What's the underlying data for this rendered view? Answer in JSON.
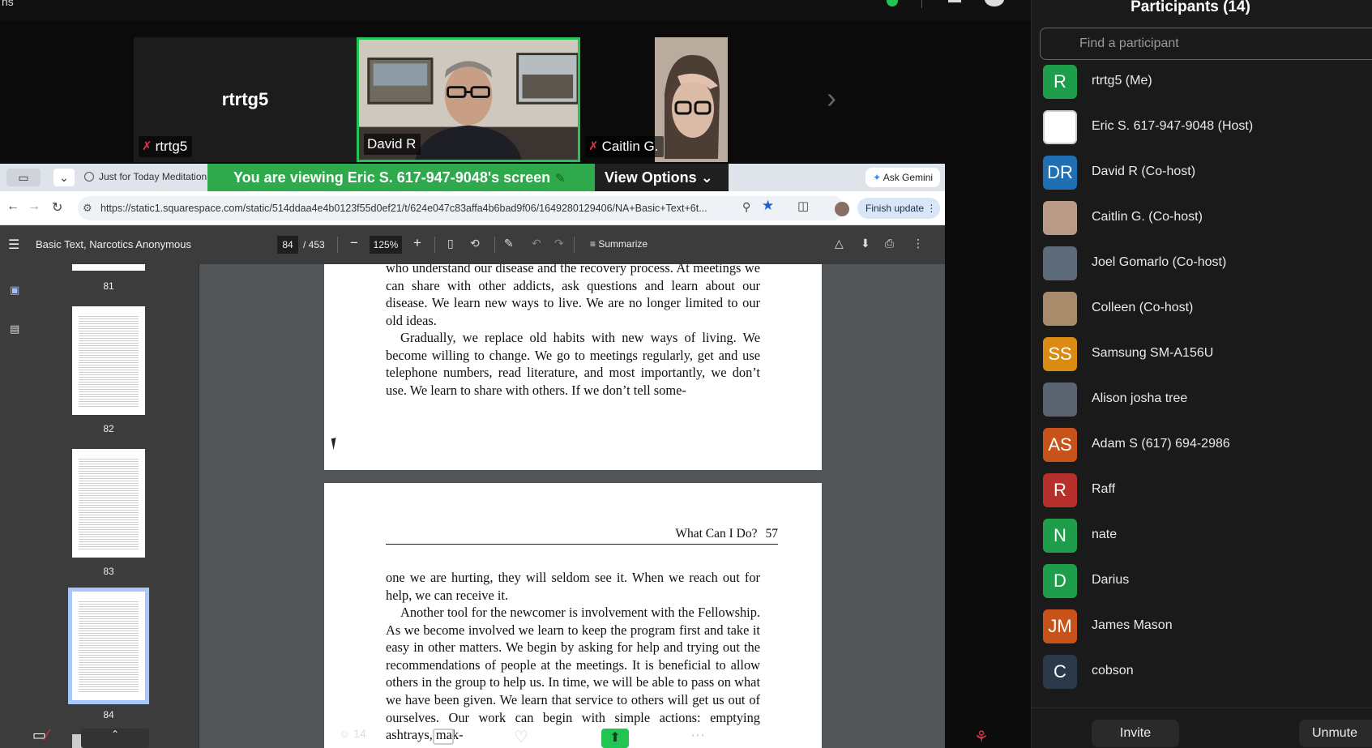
{
  "zoom": {
    "top_left_text": "ns",
    "tiles": [
      {
        "name": "rtrtg5",
        "big_name": "rtrtg5"
      },
      {
        "name": "David R"
      },
      {
        "name": "Caitlin G."
      }
    ],
    "share_banner": "You are viewing  Eric S. 617-947-9048's screen",
    "view_options": "View Options",
    "participant_count": "14"
  },
  "browser": {
    "tab_title": "Just for Today Meditation",
    "ask_gemini": "Ask Gemini",
    "url": "https://static1.squarespace.com/static/514ddaa4e4b0123f55d0ef21/t/624e047c83affa4b6bad9f06/1649280129406/NA+Basic+Text+6t...",
    "finish_update": "Finish update"
  },
  "pdf": {
    "title": "Basic Text, Narcotics Anonymous",
    "page_current": "84",
    "page_total": "/ 453",
    "zoom": "125%",
    "summarize": "Summarize",
    "thumbnails": [
      "81",
      "82",
      "83",
      "84"
    ],
    "page1_paragraphs": [
      "who understand our disease and the recovery process. At meetings we can share with other addicts, ask questions and learn about our disease. We learn new ways to live. We are no longer limited to our old ideas.",
      "Gradually, we replace old habits with new ways of living. We become willing to change. We go to meetings regularly, get and use telephone numbers, read literature, and most importantly, we don’t use. We learn to share with others. If we don’t tell some-"
    ],
    "running_head": "What Can I Do?",
    "running_page": "57",
    "page2_paragraphs": [
      "one we are hurting, they will seldom see it. When we reach out for help, we can receive it.",
      "Another tool for the newcomer is involvement with the Fellowship. As we become involved we learn to keep the program first and take it easy in other matters. We begin by asking for help and trying out the recommendations of people at the meetings. It is beneficial to allow others in the group to help us. In time, we will be able to pass on what we have been given. We learn that service to others will get us out of ourselves. Our work can begin with simple actions: emptying ashtrays, mak-"
    ]
  },
  "participants": {
    "title": "Participants (14)",
    "search_placeholder": "Find a participant",
    "list": [
      {
        "initials": "R",
        "name": "rtrtg5 (Me)",
        "color": "#1e9e4a"
      },
      {
        "initials": "",
        "name": "Eric S. 617-947-9048 (Host)",
        "color": "#ffffff"
      },
      {
        "initials": "DR",
        "name": "David R (Co-host)",
        "color": "#1f6fb5"
      },
      {
        "initials": "",
        "name": "Caitlin G. (Co-host)",
        "color": "#b89a86"
      },
      {
        "initials": "",
        "name": "Joel Gomarlo (Co-host)",
        "color": "#5d6a7a"
      },
      {
        "initials": "",
        "name": "Colleen (Co-host)",
        "color": "#a88b6a"
      },
      {
        "initials": "SS",
        "name": "Samsung SM-A156U",
        "color": "#d98b12"
      },
      {
        "initials": "",
        "name": "Alison josha tree",
        "color": "#5a6470"
      },
      {
        "initials": "AS",
        "name": "Adam S (617) 694-2986",
        "color": "#c7531a"
      },
      {
        "initials": "R",
        "name": "Raff",
        "color": "#b5302b"
      },
      {
        "initials": "N",
        "name": "nate",
        "color": "#1e9e4a"
      },
      {
        "initials": "D",
        "name": "Darius",
        "color": "#1e9e4a"
      },
      {
        "initials": "JM",
        "name": "James Mason",
        "color": "#c7531a"
      },
      {
        "initials": "C",
        "name": "cobson",
        "color": "#2a3a4a"
      }
    ],
    "invite": "Invite",
    "unmute": "Unmute"
  }
}
